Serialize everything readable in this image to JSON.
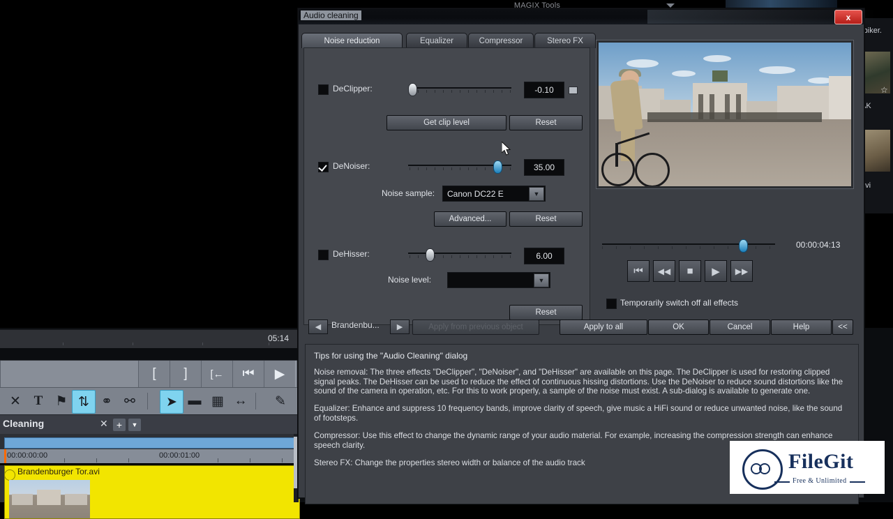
{
  "background": {
    "magix_tools_label": "MAGIX Tools",
    "timecode": "05:14",
    "arranger": {
      "title": "Cleaning",
      "close_icon": "close-icon",
      "add_label": "+",
      "dropdown_icon": "chevron-down-icon"
    },
    "timeline": {
      "ruler_start": "00:00:00:00",
      "ruler_second": "00:00:01:00",
      "clip_name": "Brandenburger Tor.avi"
    },
    "transport_buttons": [
      {
        "name": "set-in-point-button",
        "glyph": "["
      },
      {
        "name": "set-out-point-button",
        "glyph": "]"
      },
      {
        "name": "jump-to-in-button",
        "glyph": "[←"
      },
      {
        "name": "jump-to-start-button",
        "glyph": "⏮"
      },
      {
        "name": "play-button",
        "glyph": "▶"
      }
    ],
    "edit_tools": [
      {
        "name": "delete-tool",
        "glyph": "✕"
      },
      {
        "name": "title-tool",
        "glyph": "T"
      },
      {
        "name": "marker-tool",
        "glyph": "⚑"
      },
      {
        "name": "loop-tool",
        "glyph": "↺"
      },
      {
        "name": "link-tool",
        "glyph": "⚭"
      },
      {
        "name": "unlink-tool",
        "glyph": "⚯"
      },
      {
        "name": "mouse-mode-arrow-tool",
        "glyph": "➤"
      },
      {
        "name": "single-object-mode-tool",
        "glyph": "▤"
      },
      {
        "name": "curve-mode-tool",
        "glyph": "▦"
      },
      {
        "name": "stretch-mode-tool",
        "glyph": "↔"
      },
      {
        "name": "preview-audio-tool",
        "glyph": "✎"
      }
    ],
    "media_pool": {
      "item1_label": "-biker.",
      "item2_label": "AK",
      "item3_label": "avi",
      "star_icon": "star-icon"
    }
  },
  "dialog": {
    "title": "Audio cleaning",
    "close_label": "x",
    "tabs": [
      {
        "label": "Noise reduction",
        "active": true
      },
      {
        "label": "Equalizer",
        "active": false
      },
      {
        "label": "Compressor",
        "active": false
      },
      {
        "label": "Stereo FX",
        "active": false
      }
    ],
    "declipper": {
      "label": "DeClipper:",
      "checked": false,
      "value": "-0.10",
      "slider_percent": 2,
      "extra_button_icon": "small-square-icon",
      "get_clip_level_label": "Get clip level",
      "reset_label": "Reset"
    },
    "denoiser": {
      "label": "DeNoiser:",
      "checked": true,
      "value": "35.00",
      "slider_percent": 96,
      "noise_sample_label": "Noise sample:",
      "noise_sample_value": "Canon DC22 E",
      "advanced_label": "Advanced...",
      "reset_label": "Reset"
    },
    "dehisser": {
      "label": "DeHisser:",
      "checked": false,
      "value": "6.00",
      "slider_percent": 19,
      "noise_level_label": "Noise level:",
      "noise_level_value": "",
      "reset_label": "Reset"
    },
    "preview": {
      "position_percent": 80,
      "timecode": "00:00:04:13",
      "transport": [
        {
          "name": "preview-start-button",
          "glyph": "⏮"
        },
        {
          "name": "preview-rewind-button",
          "glyph": "◀◀"
        },
        {
          "name": "preview-stop-button",
          "glyph": "■"
        },
        {
          "name": "preview-play-button",
          "glyph": "▶"
        },
        {
          "name": "preview-forward-button",
          "glyph": "▶▶"
        }
      ],
      "bypass_label": "Temporarily switch off all effects",
      "bypass_checked": false
    },
    "footer": {
      "prev_icon": "arrow-left-icon",
      "next_icon": "arrow-right-icon",
      "object_name": "Brandenbu...",
      "apply_from_previous_label": "Apply from previous object",
      "apply_to_all_label": "Apply to all",
      "ok_label": "OK",
      "cancel_label": "Cancel",
      "help_label": "Help",
      "collapse_label": "<<"
    },
    "tips": {
      "title": "Tips for using the \"Audio Cleaning\" dialog",
      "paragraphs": [
        "Noise removal: The three effects \"DeClipper\", \"DeNoiser\", and \"DeHisser\" are available on this page. The DeClipper is used for restoring clipped signal peaks. The DeHisser can be used to reduce the effect of continuous hissing distortions. Use the DeNoiser to reduce sound distortions like the sound of the camera in operation, etc. For this to work properly, a sample of the noise must exist. A sub-dialog is available to generate one.",
        "Equalizer: Enhance and suppress 10 frequency bands, improve clarity of speech, give music a HiFi sound or reduce unwanted noise, like the sound of footsteps.",
        "Compressor: Use this effect to change the dynamic range of your audio material. For example, increasing the compression strength can enhance speech clarity.",
        "Stereo FX: Change the properties stereo width or balance of the audio track"
      ]
    }
  },
  "watermark": {
    "name": "FileGit",
    "tagline": "Free & Unlimited"
  },
  "colors": {
    "accent_blue": "#7fd3ef",
    "clip_yellow": "#f2e500",
    "close_red": "#c8302a",
    "dialog_bg": "#3b3e44",
    "panel_bg": "#45484e"
  }
}
